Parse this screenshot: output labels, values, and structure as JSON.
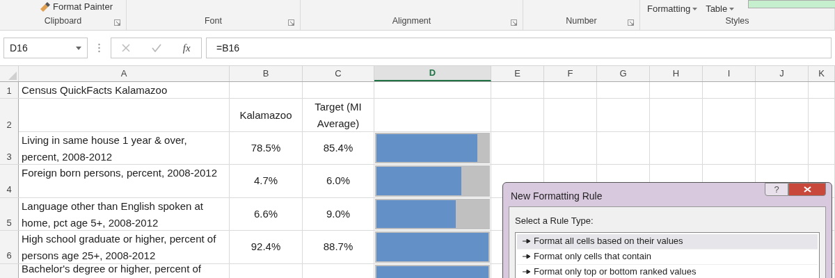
{
  "ribbon": {
    "format_painter": "Format Painter",
    "groups": [
      {
        "label": "Clipboard"
      },
      {
        "label": "Font"
      },
      {
        "label": "Alignment"
      },
      {
        "label": "Number"
      },
      {
        "label": "Styles"
      }
    ],
    "styles_buttons": [
      "Formatting",
      "Table"
    ]
  },
  "formula_bar": {
    "name_box": "D16",
    "function_label": "fx",
    "formula": "=B16"
  },
  "sheet": {
    "columns": [
      {
        "label": "A",
        "selected": false
      },
      {
        "label": "B",
        "selected": false
      },
      {
        "label": "C",
        "selected": false
      },
      {
        "label": "D",
        "selected": true
      },
      {
        "label": "E",
        "selected": false
      },
      {
        "label": "F",
        "selected": false
      },
      {
        "label": "G",
        "selected": false
      },
      {
        "label": "H",
        "selected": false
      },
      {
        "label": "I",
        "selected": false
      },
      {
        "label": "J",
        "selected": false
      },
      {
        "label": "K",
        "selected": false
      }
    ],
    "rows": [
      {
        "number": "1",
        "a": "Census QuickFacts Kalamazoo"
      },
      {
        "number": "2",
        "b": "Kalamazoo",
        "c": "Target (MI Average)"
      },
      {
        "number": "3",
        "a": "Living in same house 1 year & over, percent, 2008-2012",
        "b": "78.5%",
        "c": "85.4%",
        "bar": {
          "level": 0.9
        }
      },
      {
        "number": "4",
        "a": "Foreign born persons, percent, 2008-2012",
        "b": "4.7%",
        "c": "6.0%",
        "bar": {
          "level": 0.76
        }
      },
      {
        "number": "5",
        "a": "Language other than English spoken at home, pct age 5+, 2008-2012",
        "b": "6.6%",
        "c": "9.0%",
        "bar": {
          "level": 0.71
        }
      },
      {
        "number": "6",
        "a": "High school graduate or higher, percent of persons age 25+, 2008-2012",
        "b": "92.4%",
        "c": "88.7%",
        "bar": {
          "level": 1
        }
      },
      {
        "a": "Bachelor's degree or higher, percent of",
        "bar": {
          "level": 1
        }
      }
    ]
  },
  "dialog": {
    "title": "New Formatting Rule",
    "help": "?",
    "section_label": "Select a Rule Type:",
    "rule_types": [
      {
        "label": "Format all cells based on their values",
        "selected": true
      },
      {
        "label": "Format only cells that contain",
        "selected": false
      },
      {
        "label": "Format only top or bottom ranked values",
        "selected": false
      }
    ]
  }
}
